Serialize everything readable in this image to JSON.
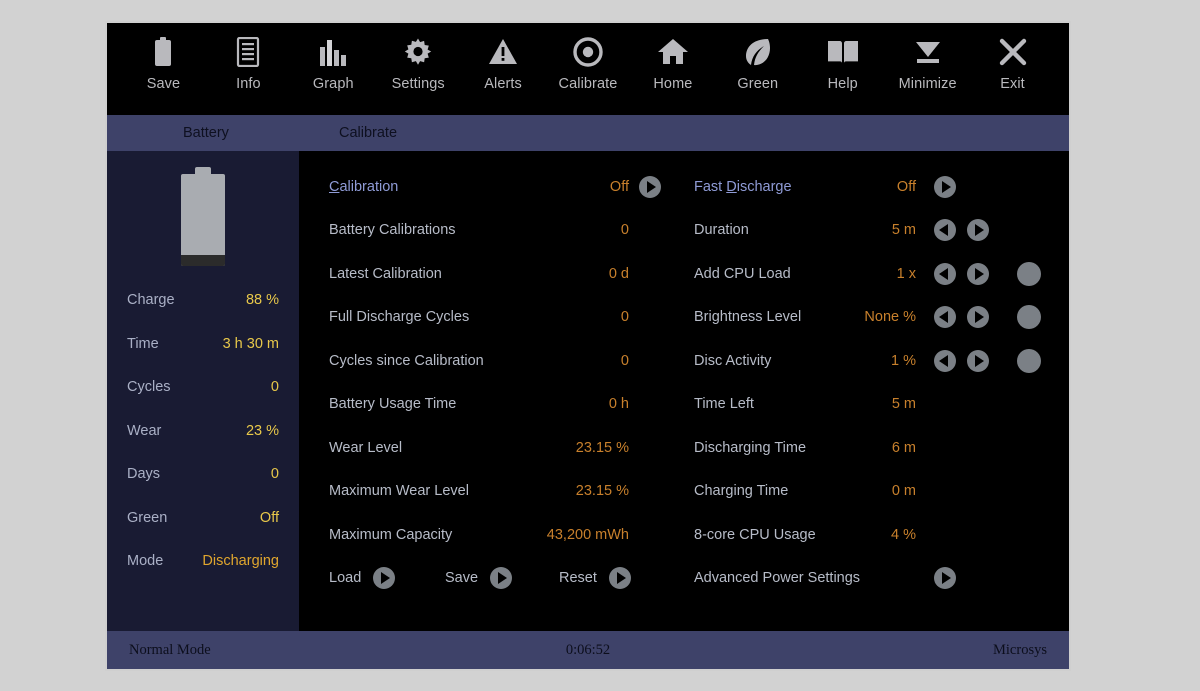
{
  "toolbar": {
    "items": [
      {
        "label": "Save",
        "icon": "battery-icon"
      },
      {
        "label": "Info",
        "icon": "document-lines-icon"
      },
      {
        "label": "Graph",
        "icon": "bar-chart-icon"
      },
      {
        "label": "Settings",
        "icon": "gear-icon"
      },
      {
        "label": "Alerts",
        "icon": "warning-triangle-icon"
      },
      {
        "label": "Calibrate",
        "icon": "target-circle-icon"
      },
      {
        "label": "Home",
        "icon": "home-icon"
      },
      {
        "label": "Green",
        "icon": "leaf-icon"
      },
      {
        "label": "Help",
        "icon": "book-icon"
      },
      {
        "label": "Minimize",
        "icon": "minimize-icon"
      },
      {
        "label": "Exit",
        "icon": "close-x-icon"
      }
    ]
  },
  "tabs": [
    {
      "label": "Battery",
      "active": true
    },
    {
      "label": "Calibrate",
      "active": false
    }
  ],
  "sidebar": {
    "battery_percent": 88,
    "rows": [
      {
        "label": "Charge",
        "value": "88 %"
      },
      {
        "label": "Time",
        "value": "3 h 30 m"
      },
      {
        "label": "Cycles",
        "value": "0"
      },
      {
        "label": "Wear",
        "value": "23 %"
      },
      {
        "label": "Days",
        "value": "0"
      },
      {
        "label": "Green",
        "value": "Off"
      },
      {
        "label": "Mode",
        "value": "Discharging"
      }
    ]
  },
  "main": {
    "left_column": [
      {
        "label": "Calibration",
        "mnemonic": "C",
        "link": true,
        "value": "Off",
        "go": true
      },
      {
        "label": "Battery Calibrations",
        "value": "0"
      },
      {
        "label": "Latest Calibration",
        "value": "0 d"
      },
      {
        "label": "Full Discharge Cycles",
        "value": "0"
      },
      {
        "label": "Cycles since Calibration",
        "value": "0"
      },
      {
        "label": "Battery Usage Time",
        "value": "0 h"
      },
      {
        "label": "Wear Level",
        "value": "23.15 %"
      },
      {
        "label": "Maximum Wear Level",
        "value": "23.15 %"
      },
      {
        "label": "Maximum Capacity",
        "value": "43,200 mWh"
      }
    ],
    "left_actions": [
      {
        "label": "Load"
      },
      {
        "label": "Save"
      },
      {
        "label": "Reset"
      }
    ],
    "right_column": [
      {
        "label": "Fast Discharge",
        "mnemonic": "D",
        "link": true,
        "value": "Off",
        "go": true
      },
      {
        "label": "Duration",
        "value": "5 m",
        "stepper": true
      },
      {
        "label": "Add CPU Load",
        "value": "1 x",
        "stepper": true,
        "dot": true
      },
      {
        "label": "Brightness Level",
        "value": "None %",
        "stepper": true,
        "dot": true
      },
      {
        "label": "Disc Activity",
        "value": "1 %",
        "stepper": true,
        "dot": true
      },
      {
        "label": "Time Left",
        "value": "5 m"
      },
      {
        "label": "Discharging Time",
        "value": "6 m"
      },
      {
        "label": "Charging Time",
        "value": "0 m"
      },
      {
        "label": "8-core CPU Usage",
        "value": "4 %"
      }
    ],
    "right_actions": [
      {
        "label": "Advanced Power Settings",
        "go": true
      }
    ]
  },
  "statusbar": {
    "mode": "Normal Mode",
    "elapsed": "0:06:52",
    "brand": "Microsys"
  },
  "colors": {
    "toolbar_bg": "#000000",
    "tab_bg": "#3e4269",
    "sidebar_bg": "#191b33",
    "main_bg": "#000000",
    "value_amber": "#c8802c",
    "sidebar_value": "#e8c84a",
    "label_gray": "#b7bcc8",
    "link_blue": "#8f9bd6",
    "button_gray": "#7b8086"
  }
}
